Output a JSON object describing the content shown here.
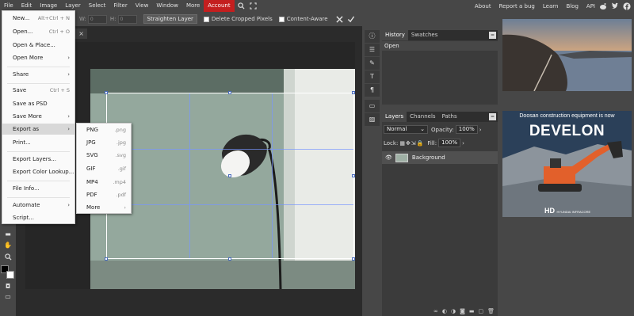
{
  "menubar": {
    "items": [
      "File",
      "Edit",
      "Image",
      "Layer",
      "Select",
      "Filter",
      "View",
      "Window",
      "More",
      "Account"
    ],
    "right": [
      "About",
      "Report a bug",
      "Learn",
      "Blog",
      "API"
    ]
  },
  "options": {
    "w_label": "W:",
    "w_value": "0",
    "h_label": "H:",
    "h_value": "0",
    "straighten": "Straighten Layer",
    "delete_cropped": "Delete Cropped Pixels",
    "content_aware": "Content-Aware"
  },
  "file_menu": {
    "new": "New...",
    "new_sc": "Alt+Ctrl + N",
    "open": "Open...",
    "open_sc": "Ctrl + O",
    "open_place": "Open & Place...",
    "open_more": "Open More",
    "share": "Share",
    "save": "Save",
    "save_sc": "Ctrl + S",
    "save_psd": "Save as PSD",
    "save_more": "Save More",
    "export_as": "Export as",
    "print": "Print...",
    "export_layers": "Export Layers...",
    "export_color_lookup": "Export Color Lookup...",
    "file_info": "File Info...",
    "automate": "Automate",
    "script": "Script..."
  },
  "export_menu": [
    {
      "label": "PNG",
      "ext": ".png"
    },
    {
      "label": "JPG",
      "ext": ".jpg"
    },
    {
      "label": "SVG",
      "ext": ".svg"
    },
    {
      "label": "GIF",
      "ext": ".gif"
    },
    {
      "label": "MP4",
      "ext": ".mp4"
    },
    {
      "label": "PDF",
      "ext": ".pdf"
    },
    {
      "label": "More",
      "ext": ""
    }
  ],
  "history_panel": {
    "tabs": [
      "History",
      "Swatches"
    ],
    "items": [
      "Open"
    ]
  },
  "layers_panel": {
    "tabs": [
      "Layers",
      "Channels",
      "Paths"
    ],
    "blend_mode": "Normal",
    "opacity_label": "Opacity:",
    "opacity_value": "100%",
    "lock_label": "Lock:",
    "fill_label": "Fill:",
    "fill_value": "100%",
    "layer_name": "Background"
  },
  "ads": {
    "headline": "Doosan construction equipment is now",
    "brand": "DEVELON",
    "logo": "HD",
    "logo_sub": "HYUNDAI INFRACORE"
  },
  "colors": {
    "accent_account": "#c41f1f",
    "menu_bg": "#fafafa",
    "selection_line": "#7896ff"
  }
}
